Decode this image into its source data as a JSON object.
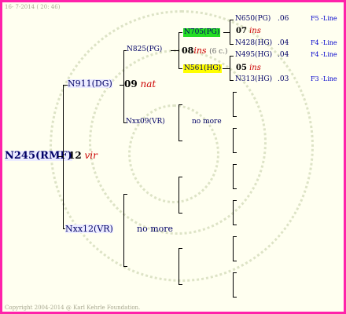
{
  "header": {
    "date": "16- 7-2014 ( 20: 46)"
  },
  "footer": {
    "copyright": "Copyright 2004-2014 @ Karl Kehrle Foundation."
  },
  "root": {
    "name": "N245(RMF)",
    "num": "12",
    "trait": "vir"
  },
  "parents": {
    "p1": {
      "name": "N911(DG)",
      "num": "09",
      "trait": "nat"
    },
    "p2": {
      "name": "Nxx12(VR)",
      "more": "no more"
    }
  },
  "grandparents": {
    "g1": {
      "name": "N825(PG)",
      "num": "08",
      "trait": "ins",
      "count": "(6 c.)"
    },
    "g2": {
      "name": "Nxx09(VR)",
      "more": "no more"
    }
  },
  "greatgrand": {
    "gg1": {
      "name": "N705(PG)",
      "num": "07",
      "trait": "ins"
    },
    "gg2": {
      "name": "N561(HG)",
      "num": "05",
      "trait": "ins"
    }
  },
  "ancestors": [
    {
      "name": "N650(PG)",
      "value": ".06",
      "line": "F5 -Line"
    },
    {
      "name": "N428(HG)",
      "value": ".04",
      "line": "F4 -Line"
    },
    {
      "name": "N495(HG)",
      "value": ".04",
      "line": "F4 -Line"
    },
    {
      "name": "N313(HG)",
      "value": ".03",
      "line": "F3 -Line"
    }
  ]
}
